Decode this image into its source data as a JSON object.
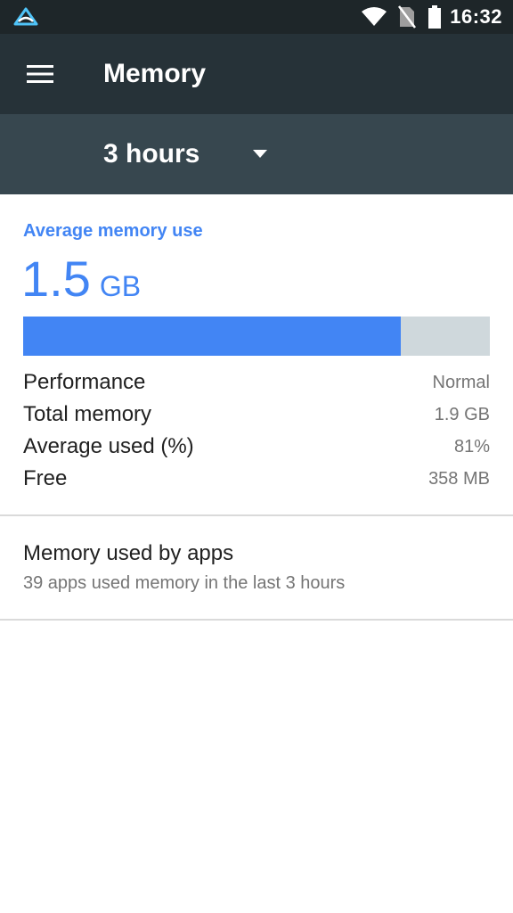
{
  "status_bar": {
    "time": "16:32",
    "icons": [
      "app-notification-icon",
      "wifi-icon",
      "no-sim-icon",
      "battery-icon"
    ]
  },
  "app_bar": {
    "title": "Memory",
    "menu_icon": "menu-icon"
  },
  "filter": {
    "selected_period": "3 hours",
    "dropdown_icon": "arrow-drop-down-icon"
  },
  "summary": {
    "heading": "Average memory use",
    "value": "1.5",
    "unit": "GB",
    "usage_fraction": 0.81,
    "stats": [
      {
        "label": "Performance",
        "value": "Normal"
      },
      {
        "label": "Total memory",
        "value": "1.9 GB"
      },
      {
        "label": "Average used (%)",
        "value": "81%"
      },
      {
        "label": "Free",
        "value": "358 MB"
      }
    ]
  },
  "apps": {
    "title": "Memory used by apps",
    "subtitle": "39 apps used memory in the last 3 hours"
  },
  "colors": {
    "status_bar": "#1e2629",
    "app_bar": "#263238",
    "filter_bar": "#37474f",
    "accent": "#4285f4",
    "bar_track": "#cfd8dc"
  }
}
